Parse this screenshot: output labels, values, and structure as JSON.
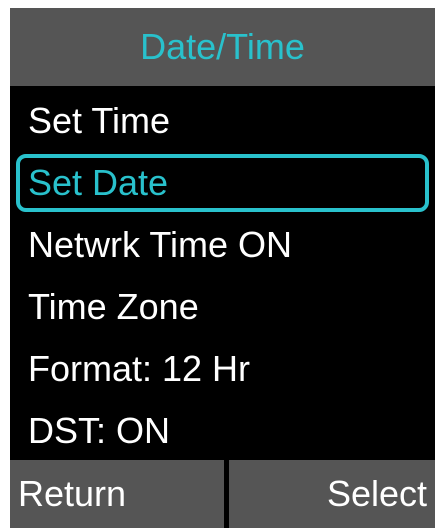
{
  "header": {
    "title": "Date/Time"
  },
  "menu": {
    "items": [
      {
        "label": "Set Time"
      },
      {
        "label": "Set Date"
      },
      {
        "label": "Netwrk Time ON"
      },
      {
        "label": "Time Zone"
      },
      {
        "label": "Format: 12 Hr"
      },
      {
        "label": "DST: ON"
      }
    ],
    "selected_label": "Set Date"
  },
  "softkeys": {
    "left_label": "Return",
    "right_label": "Select"
  },
  "colors": {
    "accent": "#29c1cc",
    "bar_background": "#555555",
    "screen_background": "#000000",
    "text": "#ffffff"
  }
}
